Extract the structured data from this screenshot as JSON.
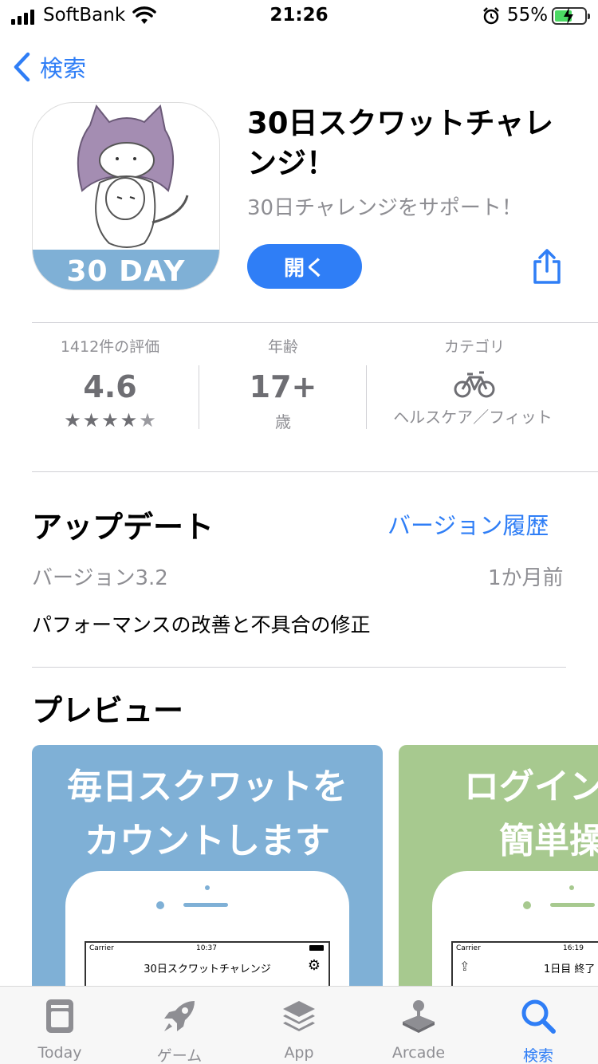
{
  "status_bar": {
    "carrier": "SoftBank",
    "time": "21:26",
    "battery_percent": "55%",
    "battery_level": 0.55
  },
  "nav": {
    "back_label": "検索"
  },
  "app": {
    "icon_text": "30 DAY",
    "title": "30日スクワットチャレンジ！",
    "subtitle": "30日チャレンジをサポート！",
    "open_label": "開く"
  },
  "info": {
    "ratings_label": "1412件の評価",
    "rating_value": "4.6",
    "stars": 4.6,
    "age_label": "年齢",
    "age_value": "17+",
    "age_unit": "歳",
    "category_label": "カテゴリ",
    "category_value": "ヘルスケア／フィット"
  },
  "update": {
    "heading": "アップデート",
    "history_link": "バージョン履歴",
    "version": "バージョン3.2",
    "date": "1か月前",
    "notes": "パフォーマンスの改善と不具合の修正"
  },
  "preview": {
    "heading": "プレビュー",
    "card1": {
      "line1": "毎日スクワットを",
      "line2": "カウントします",
      "carrier": "Carrier",
      "time": "10:37",
      "screen_title": "30日スクワットチャレンジ"
    },
    "card2": {
      "line1": "ログイン",
      "line2": "簡単操",
      "carrier": "Carrier",
      "time": "16:19",
      "screen_title": "1日目 終了"
    }
  },
  "tabs": [
    {
      "label": "Today",
      "icon": "today-icon"
    },
    {
      "label": "ゲーム",
      "icon": "rocket-icon"
    },
    {
      "label": "App",
      "icon": "app-stack-icon"
    },
    {
      "label": "Arcade",
      "icon": "joystick-icon"
    },
    {
      "label": "検索",
      "icon": "search-icon",
      "active": true
    }
  ],
  "colors": {
    "accent": "#2f7ef6",
    "card1_bg": "#7fb0d6",
    "card2_bg": "#a7c98f",
    "battery_fill": "#4cd964"
  }
}
